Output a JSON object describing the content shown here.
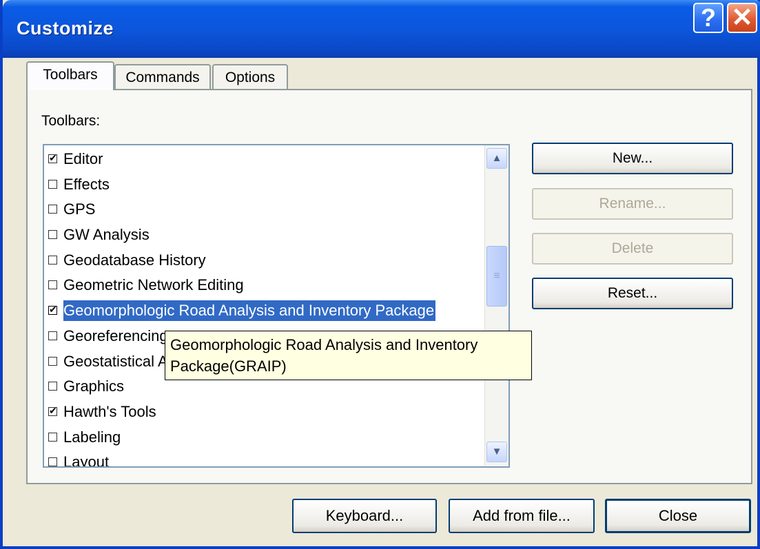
{
  "window": {
    "title": "Customize"
  },
  "title_buttons": {
    "help": "?",
    "close": "✕"
  },
  "tabs": [
    {
      "label": "Toolbars",
      "active": true
    },
    {
      "label": "Commands",
      "active": false
    },
    {
      "label": "Options",
      "active": false
    }
  ],
  "toolbars_panel": {
    "group_label": "Toolbars:",
    "items": [
      {
        "label": "Editor",
        "checked": true
      },
      {
        "label": "Effects",
        "checked": false
      },
      {
        "label": "GPS",
        "checked": false
      },
      {
        "label": "GW Analysis",
        "checked": false
      },
      {
        "label": "Geodatabase History",
        "checked": false
      },
      {
        "label": "Geometric Network Editing",
        "checked": false
      },
      {
        "label": "Geomorphologic Road Analysis and Inventory Package",
        "checked": true,
        "selected": true
      },
      {
        "label": "Georeferencing",
        "checked": false
      },
      {
        "label": "Geostatistical Analyst",
        "checked": false
      },
      {
        "label": "Graphics",
        "checked": false
      },
      {
        "label": "Hawth's Tools",
        "checked": true
      },
      {
        "label": "Labeling",
        "checked": false
      },
      {
        "label": "Layout",
        "checked": false
      }
    ],
    "tooltip": "Geomorphologic Road Analysis and Inventory Package(GRAIP)"
  },
  "side_buttons": {
    "new": {
      "label": "New...",
      "enabled": true
    },
    "rename": {
      "label": "Rename...",
      "enabled": false
    },
    "delete": {
      "label": "Delete",
      "enabled": false
    },
    "reset": {
      "label": "Reset...",
      "enabled": true
    }
  },
  "bottom_buttons": {
    "keyboard": "Keyboard...",
    "add_from_file": "Add from file...",
    "close": "Close"
  }
}
